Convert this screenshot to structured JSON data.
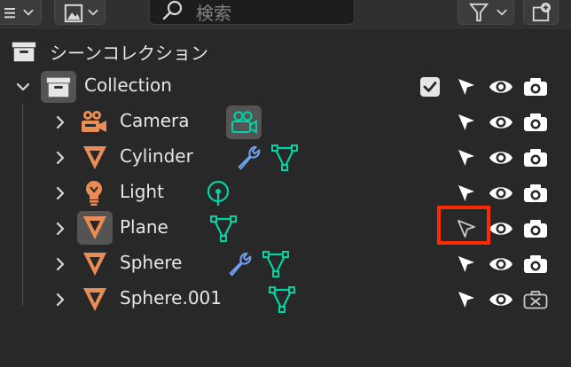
{
  "toolbar": {
    "search_placeholder": "検索",
    "display_mode_icon": "list-icon",
    "view_icon": "image-icon",
    "filter_icon": "filter-icon",
    "new_collection_icon": "new-collection-icon"
  },
  "tree": {
    "scene_collection": {
      "label": "シーンコレクション",
      "icon": "collection-box-icon"
    },
    "collection": {
      "label": "Collection",
      "icon": "collection-box-icon",
      "checked": true
    },
    "objects": [
      {
        "label": "Camera",
        "icon": "camera-icon",
        "modifiers": [
          "camera-data-icon"
        ],
        "renderable": true
      },
      {
        "label": "Cylinder",
        "icon": "mesh-icon",
        "modifiers": [
          "wrench-icon",
          "mesh-data-icon"
        ],
        "renderable": true
      },
      {
        "label": "Light",
        "icon": "light-bulb-icon",
        "modifiers": [
          "light-data-icon"
        ],
        "renderable": true
      },
      {
        "label": "Plane",
        "icon": "mesh-icon",
        "modifiers": [
          "mesh-data-icon"
        ],
        "renderable": true,
        "active": true,
        "selectable": false
      },
      {
        "label": "Sphere",
        "icon": "mesh-icon",
        "modifiers": [
          "wrench-icon",
          "mesh-data-icon"
        ],
        "renderable": true
      },
      {
        "label": "Sphere.001",
        "icon": "mesh-icon",
        "modifiers": [
          "mesh-data-icon"
        ],
        "renderable": false
      }
    ]
  },
  "colors": {
    "background": "#282828",
    "object_orange": "#e98c55",
    "mesh_data_green": "#00d4a3",
    "modifier_blue": "#6f9fee",
    "highlight_red": "#ff2a00"
  }
}
